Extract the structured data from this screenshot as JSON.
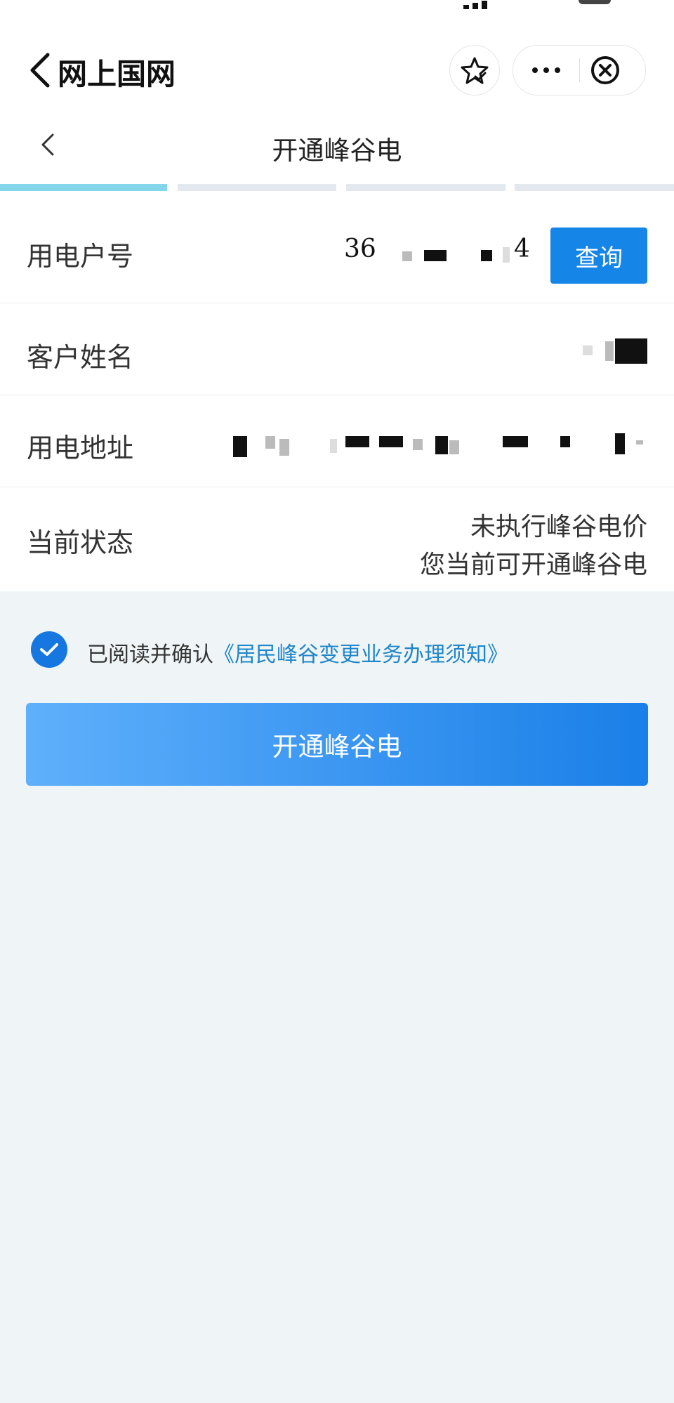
{
  "app": {
    "title": "网上国网"
  },
  "page": {
    "title": "开通峰谷电"
  },
  "steps": {
    "active_color": "#84d6ea",
    "inactive_color": "#e3e8ee"
  },
  "form": {
    "account": {
      "label": "用电户号",
      "value": "36",
      "value_suffix": "4",
      "query_label": "查询"
    },
    "name": {
      "label": "客户姓名"
    },
    "address": {
      "label": "用电地址"
    },
    "status": {
      "label": "当前状态",
      "line1": "未执行峰谷电价",
      "line2": "您当前可开通峰谷电"
    }
  },
  "agreement": {
    "checked": true,
    "prefix": "已阅读并确认",
    "link": "《居民峰谷变更业务办理须知》"
  },
  "submit": {
    "label": "开通峰谷电"
  },
  "colors": {
    "primary": "#1685e8",
    "link": "#1f86c9",
    "background": "#eff4f7"
  },
  "icons": [
    "back-icon",
    "star-icon",
    "more-icon",
    "close-circle-icon",
    "chevron-left-icon",
    "check-icon"
  ]
}
